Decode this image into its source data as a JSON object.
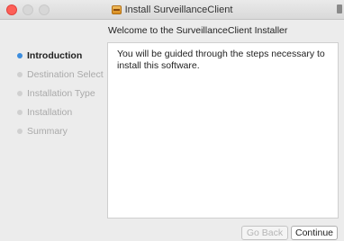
{
  "window": {
    "title": "Install SurveillanceClient",
    "title_icon": "package-icon",
    "accent_color": "#3c8dde"
  },
  "header": {
    "text": "Welcome to the SurveillanceClient Installer"
  },
  "sidebar": {
    "steps": [
      {
        "label": "Introduction",
        "active": true
      },
      {
        "label": "Destination Select",
        "active": false
      },
      {
        "label": "Installation Type",
        "active": false
      },
      {
        "label": "Installation",
        "active": false
      },
      {
        "label": "Summary",
        "active": false
      }
    ]
  },
  "content": {
    "body": "You will be guided through the steps necessary to install this software."
  },
  "buttons": {
    "go_back": "Go Back",
    "continue": "Continue"
  }
}
